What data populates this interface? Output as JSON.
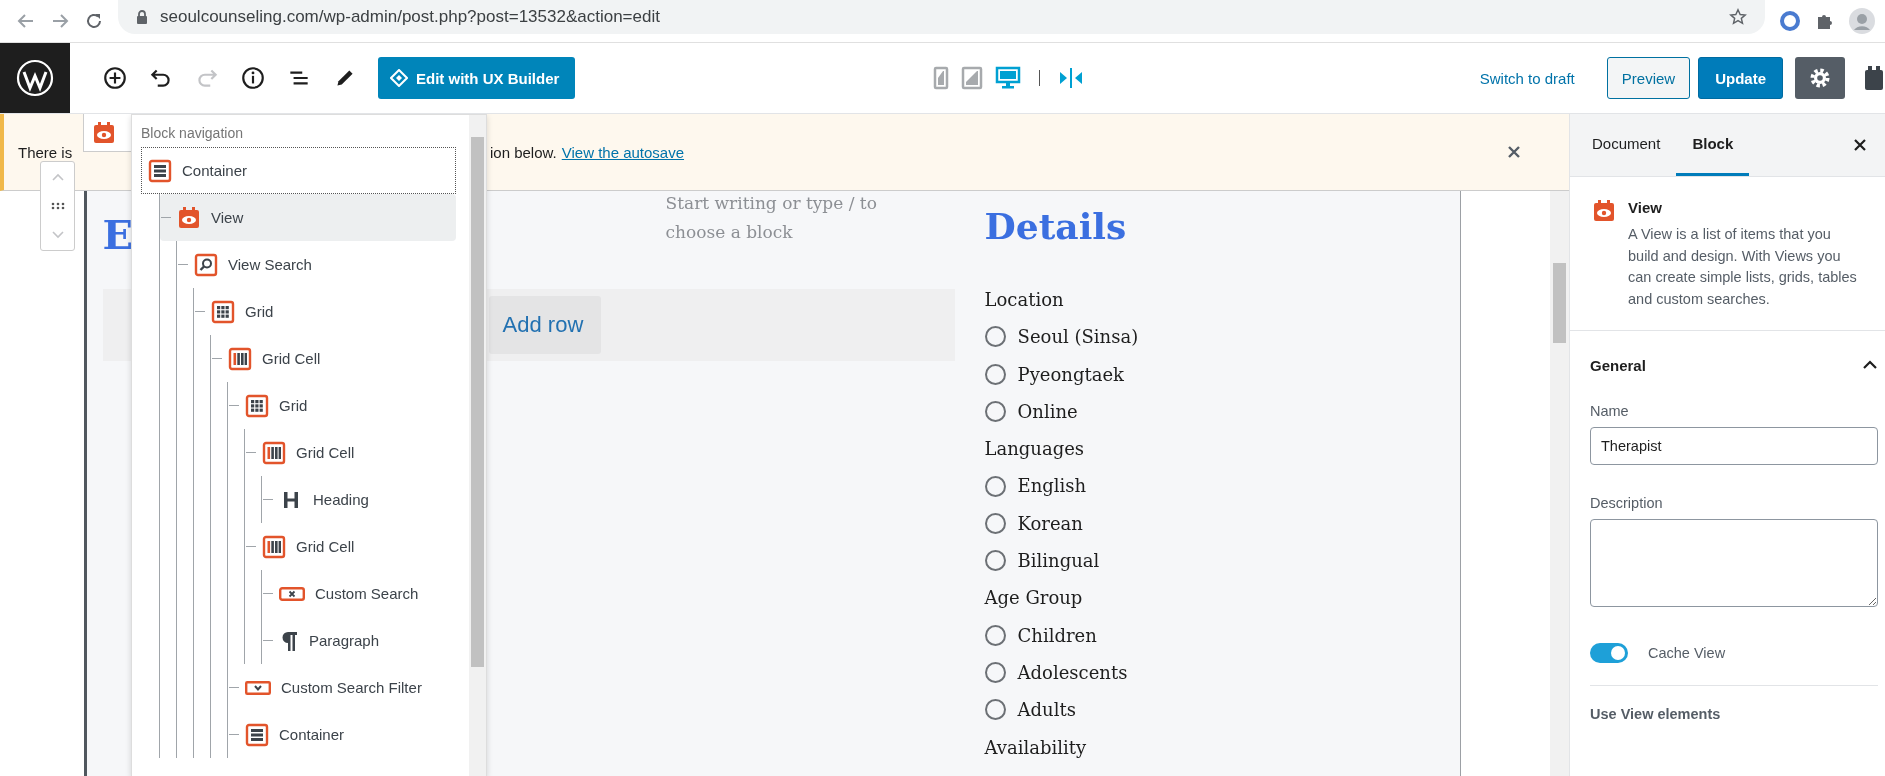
{
  "browser": {
    "url": "seoulcounseling.com/wp-admin/post.php?post=13532&action=edit"
  },
  "toolbar": {
    "tools": [
      {
        "kind": "add",
        "disabled": false
      },
      {
        "kind": "undo",
        "disabled": false
      },
      {
        "kind": "redo",
        "disabled": true
      },
      {
        "kind": "info",
        "disabled": false
      },
      {
        "kind": "list",
        "disabled": false
      },
      {
        "kind": "edit",
        "disabled": false
      }
    ],
    "builder_button": "Edit with UX Builder",
    "devices": [
      {
        "kind": "mobile",
        "selected": false
      },
      {
        "kind": "tablet",
        "selected": false
      },
      {
        "kind": "desktop",
        "selected": true
      }
    ],
    "switch_to_draft": "Switch to draft",
    "preview": "Preview",
    "update": "Update"
  },
  "notice": {
    "text_start": "There is",
    "text_end": "ion below.",
    "link": "View the autosave"
  },
  "block_navigation": {
    "title": "Block navigation",
    "items": [
      {
        "label": "Container",
        "kind": "container",
        "selected": false,
        "focused": true,
        "children": [
          {
            "label": "View",
            "kind": "view",
            "selected": true,
            "focused": false,
            "children": [
              {
                "label": "View Search",
                "kind": "search",
                "selected": false,
                "focused": false,
                "children": [
                  {
                    "label": "Grid",
                    "kind": "grid",
                    "selected": false,
                    "focused": false,
                    "children": [
                      {
                        "label": "Grid Cell",
                        "kind": "gridcell",
                        "selected": false,
                        "focused": false,
                        "children": [
                          {
                            "label": "Grid",
                            "kind": "grid",
                            "selected": false,
                            "focused": false,
                            "children": [
                              {
                                "label": "Grid Cell",
                                "kind": "gridcell",
                                "selected": false,
                                "focused": false,
                                "children": [
                                  {
                                    "label": "Heading",
                                    "kind": "heading",
                                    "selected": false,
                                    "focused": false
                                  }
                                ]
                              },
                              {
                                "label": "Grid Cell",
                                "kind": "gridcell",
                                "selected": false,
                                "focused": false,
                                "children": [
                                  {
                                    "label": "Custom Search",
                                    "kind": "reset",
                                    "selected": false,
                                    "focused": false
                                  },
                                  {
                                    "label": "Paragraph",
                                    "kind": "paragraph",
                                    "selected": false,
                                    "focused": false
                                  }
                                ]
                              }
                            ]
                          },
                          {
                            "label": "Custom Search Filter",
                            "kind": "filter",
                            "selected": false,
                            "focused": false
                          },
                          {
                            "label": "Container",
                            "kind": "container",
                            "selected": false,
                            "focused": false
                          }
                        ]
                      }
                    ]
                  }
                ]
              }
            ]
          }
        ]
      }
    ]
  },
  "editor": {
    "heading": "E",
    "placeholder": "Start writing or type / to choose a block",
    "add_row": "Add row",
    "details_heading": "Details",
    "filters": [
      {
        "label": "Location",
        "options": [
          {
            "label": "Seoul (Sinsa)",
            "selected": false
          },
          {
            "label": "Pyeongtaek",
            "selected": false
          },
          {
            "label": "Online",
            "selected": false
          }
        ]
      },
      {
        "label": "Languages",
        "options": [
          {
            "label": "English",
            "selected": false
          },
          {
            "label": "Korean",
            "selected": false
          },
          {
            "label": "Bilingual",
            "selected": false
          }
        ]
      },
      {
        "label": "Age Group",
        "options": [
          {
            "label": "Children",
            "selected": false
          },
          {
            "label": "Adolescents",
            "selected": false
          },
          {
            "label": "Adults",
            "selected": false
          }
        ]
      },
      {
        "label": "Availability"
      }
    ]
  },
  "sidebar": {
    "tabs": [
      {
        "label": "Document",
        "selected": false
      },
      {
        "label": "Block",
        "selected": true
      }
    ],
    "block": {
      "title": "View",
      "description": "A View is a list of items that you build and design. With Views you can create simple lists, grids, tables and custom searches."
    },
    "panel": {
      "title": "General",
      "expanded": true,
      "name_label": "Name",
      "name_value": "Therapist",
      "description_label": "Description",
      "toggle": {
        "label": "Cache View",
        "on": true
      }
    },
    "section": "Use View elements"
  }
}
